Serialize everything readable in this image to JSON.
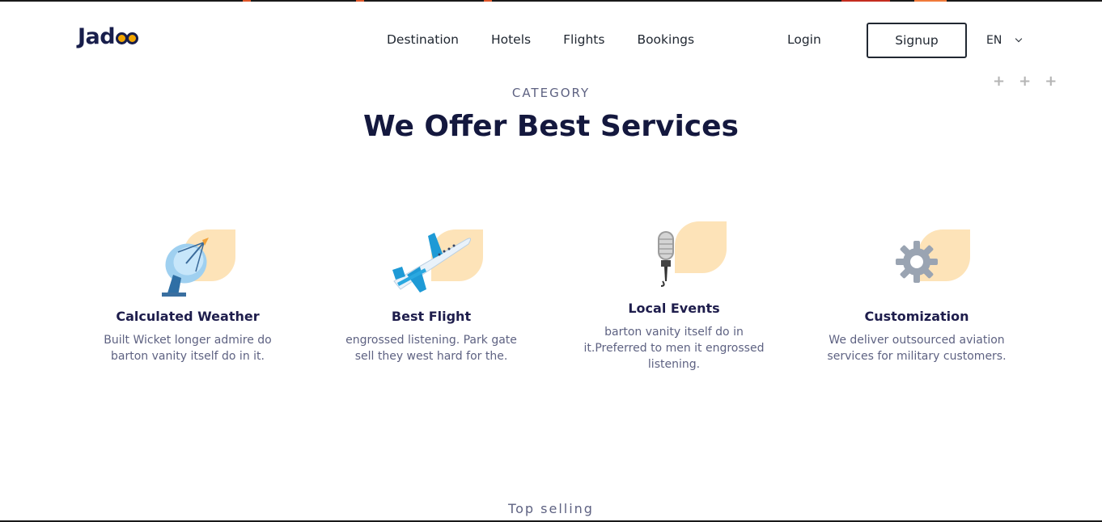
{
  "brand": {
    "logo_text": "Jad",
    "logo_end": "oo"
  },
  "nav": {
    "items": [
      "Destination",
      "Hotels",
      "Flights",
      "Bookings"
    ],
    "login": "Login",
    "signup": "Signup",
    "language": "EN"
  },
  "decoration": {
    "plus": [
      "+",
      "+",
      "+"
    ]
  },
  "section": {
    "eyebrow": "CATEGORY",
    "title": "We Offer Best Services"
  },
  "services": [
    {
      "title": "Calculated Weather",
      "text": "Built Wicket longer admire do barton vanity itself do in it.",
      "icon": "satellite-dish-icon"
    },
    {
      "title": "Best Flight",
      "text": "engrossed listening. Park gate sell they west hard for the.",
      "icon": "airplane-icon"
    },
    {
      "title": "Local Events",
      "text": "barton vanity itself do in it.Preferred to men it engrossed listening.",
      "icon": "microphone-icon"
    },
    {
      "title": "Customization",
      "text": "We deliver outsourced aviation services for military customers.",
      "icon": "gear-icon"
    }
  ],
  "next_section": {
    "eyebrow": "Top selling"
  },
  "colors": {
    "accent_blob": "#fde3b8",
    "heading": "#14183e",
    "text": "#5e6282",
    "logo_dot": "#f1a501"
  }
}
